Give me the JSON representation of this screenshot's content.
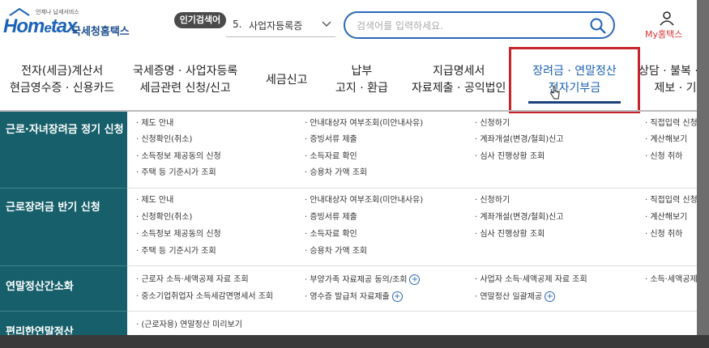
{
  "header": {
    "logo": {
      "small": "언제나 납세서비스",
      "brand_pre": "Hom",
      "brand_e": "e",
      "brand_post": "tax",
      "kr": "국세청홈택스"
    },
    "popular_badge": "인기검색어",
    "popular": {
      "num": "5.",
      "term": "사업자등록증"
    },
    "search_placeholder": "검색어를 입력하세요.",
    "my": "My홈택스",
    "extra": "전"
  },
  "nav": [
    {
      "l1": "전자(세금)계산서",
      "l2": "현금영수증 · 신용카드"
    },
    {
      "l1": "국세증명 · 사업자등록",
      "l2": "세금관련 신청/신고"
    },
    {
      "l1": "세금신고"
    },
    {
      "l1": "납부",
      "l2": "고지 · 환급"
    },
    {
      "l1": "지급명세서",
      "l2": "자료제출 · 공익법인"
    },
    {
      "l1": "장려금 · 연말정산",
      "l2": "전자기부금"
    },
    {
      "l1": "상담 · 불복 · 고충",
      "l2": "제보 · 기타"
    }
  ],
  "sections": [
    {
      "title": "근로·자녀장려금 정기 신청",
      "cols": [
        [
          "· 제도 안내",
          "· 신청확인(취소)",
          "· 소득정보 제공동의 신청",
          "· 주택 등 기준시가 조회"
        ],
        [
          "· 안내대상자 여부조회(미안내사유)",
          "· 증빙서류 제출",
          "· 소득자료 확인",
          "· 승용차 가액 조회"
        ],
        [
          "· 신청하기",
          "· 계좌개설(변경/철회)신고",
          "· 심사 진행상황 조회"
        ],
        [
          "· 직접입력 신청",
          "· 계산해보기",
          "· 신청 취하"
        ]
      ]
    },
    {
      "title": "근로장려금 반기 신청",
      "cols": [
        [
          "· 제도 안내",
          "· 신청확인(취소)",
          "· 소득정보 제공동의 신청",
          "· 주택 등 기준시가 조회"
        ],
        [
          "· 안내대상자 여부조회(미안내사유)",
          "· 증빙서류 제출",
          "· 소득자료 확인",
          "· 승용차 가액 조회"
        ],
        [
          "· 신청하기",
          "· 계좌개설(변경/철회)신고",
          "· 심사 진행상황 조회"
        ],
        [
          "· 직접입력 신청",
          "· 계산해보기",
          "· 신청 취하"
        ]
      ]
    },
    {
      "title": "연말정산간소화",
      "cols": [
        [
          "· 근로자 소득·세액공제 자료 조회",
          "· 중소기업취업자 소득세감면명세서 조회"
        ],
        [
          "· 부양가족 자료제공 동의/조회",
          "· 영수증 발급처 자료제출"
        ],
        [
          "· 사업자 소득·세액공제 자료 조회",
          "· 연말정산 일괄제공"
        ],
        [
          "· 소득·세액공제 자"
        ]
      ]
    },
    {
      "title": "편리한연말정산",
      "cols": [
        [
          "· (근로자용) 연말정산 미리보기"
        ]
      ]
    }
  ]
}
